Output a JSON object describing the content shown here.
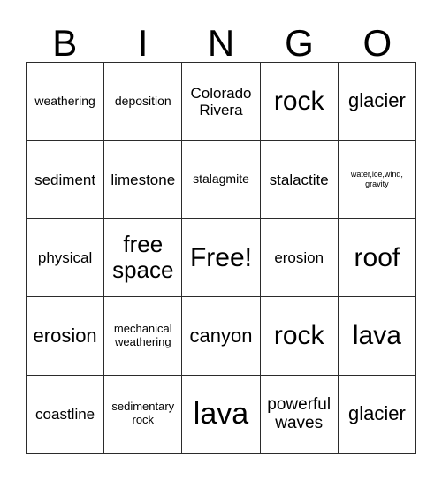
{
  "card": {
    "title": "BINGO",
    "header_letters": [
      "B",
      "I",
      "N",
      "G",
      "O"
    ],
    "columns": 5,
    "rows": 5,
    "free_space_position": "row3-col3",
    "colors": {
      "background": "#ffffff",
      "text": "#000000",
      "grid_line": "#2b2b2b"
    },
    "cells": [
      [
        {
          "label": "weathering",
          "size": "sm"
        },
        {
          "label": "deposition",
          "size": "sm"
        },
        {
          "label": "Colorado Rivera",
          "size": "md"
        },
        {
          "label": "rock",
          "size": "3xl"
        },
        {
          "label": "glacier",
          "size": "xl"
        }
      ],
      [
        {
          "label": "sediment",
          "size": "md"
        },
        {
          "label": "limestone",
          "size": "md"
        },
        {
          "label": "stalagmite",
          "size": "sm"
        },
        {
          "label": "stalactite",
          "size": "md"
        },
        {
          "label": "water,ice,wind, gravity",
          "size": "xxs"
        }
      ],
      [
        {
          "label": "physical",
          "size": "md"
        },
        {
          "label": "free space",
          "size": "2xl"
        },
        {
          "label": "Free!",
          "size": "3xl"
        },
        {
          "label": "erosion",
          "size": "md"
        },
        {
          "label": "roof",
          "size": "3xl"
        }
      ],
      [
        {
          "label": "erosion",
          "size": "xl"
        },
        {
          "label": "mechanical weathering",
          "size": "xs"
        },
        {
          "label": "canyon",
          "size": "xl"
        },
        {
          "label": "rock",
          "size": "3xl"
        },
        {
          "label": "lava",
          "size": "3xl"
        }
      ],
      [
        {
          "label": "coastline",
          "size": "md"
        },
        {
          "label": "sedimentary rock",
          "size": "xs"
        },
        {
          "label": "lava",
          "size": "4xl"
        },
        {
          "label": "powerful waves",
          "size": "lg"
        },
        {
          "label": "glacier",
          "size": "xl"
        }
      ]
    ]
  }
}
